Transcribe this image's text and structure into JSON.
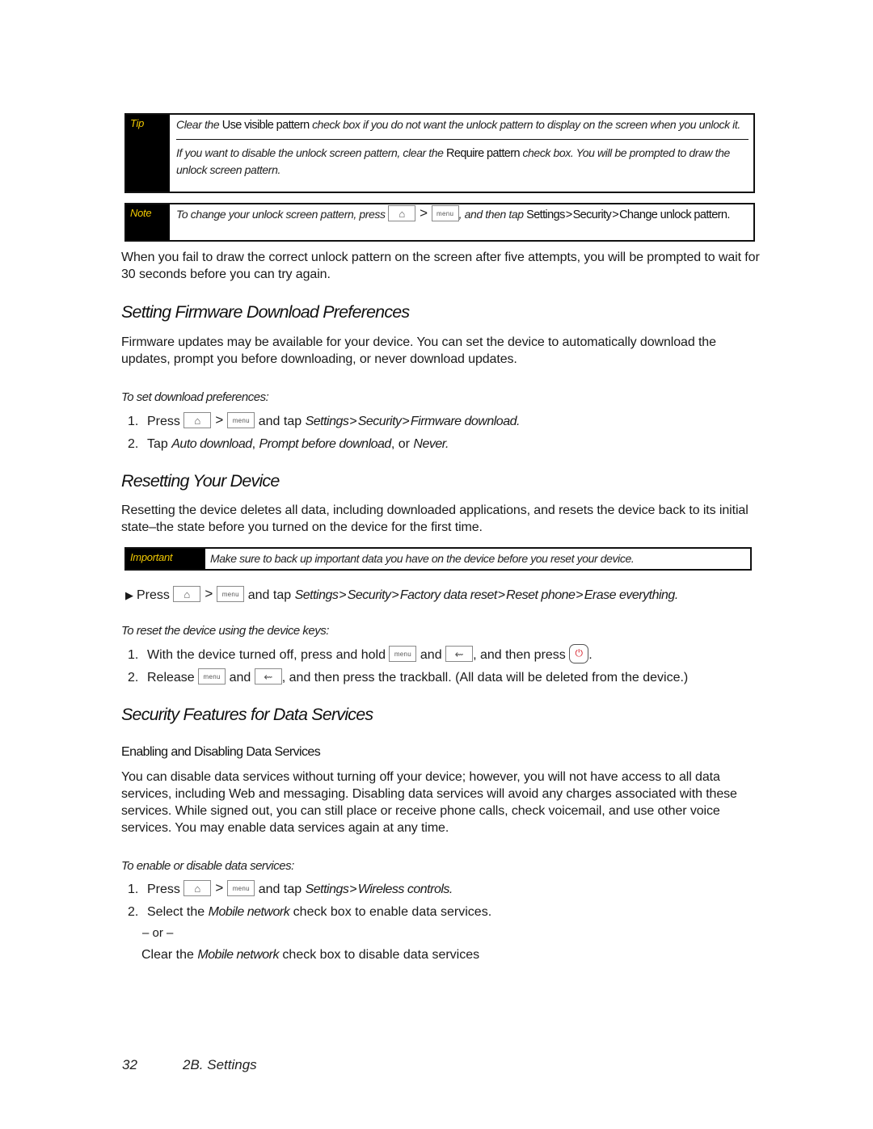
{
  "tip": {
    "label": "Tip",
    "item1": {
      "pre": "Clear the ",
      "ui": "Use visible pattern",
      "post": " check box if you do not want the unlock pattern to display on the screen when you unlock it."
    },
    "item2": {
      "pre": "If you want to disable the unlock screen pattern, clear the ",
      "ui": "Require pattern",
      "post": " check box. You will be prompted to draw the unlock screen pattern."
    }
  },
  "note": {
    "label": "Note",
    "pre": "To change your unlock screen pattern, press",
    "mid": ", and then tap ",
    "path": [
      "Settings",
      "Security",
      "Change unlock pattern"
    ],
    "post": "."
  },
  "keys": {
    "home_icon": "⌂",
    "menu_label": "menu",
    "back_icon": "⇜",
    "end_icon": "⏻",
    "separator": ">"
  },
  "intro_para": "When you fail to draw the correct unlock pattern on the screen after five attempts, you will be prompted to wait for 30 seconds before you can try again.",
  "firmware": {
    "heading": "Setting Firmware Download Preferences",
    "para": "Firmware updates may be available for your device. You can set the device to automatically download the updates, prompt you before downloading, or never download updates.",
    "procedure_title": "To set download preferences:",
    "step1": {
      "num": "1.",
      "press": "Press",
      "and_tap": " and tap ",
      "path": [
        "Settings",
        "Security",
        "Firmware download"
      ],
      "end": "."
    },
    "step2": {
      "num": "2.",
      "pre": "Tap ",
      "opt1": "Auto download",
      "comma": ", ",
      "opt2": "Prompt before download",
      "or": ", or ",
      "opt3": "Never",
      "end": "."
    }
  },
  "reset": {
    "heading": "Resetting Your Device",
    "para": "Resetting the device deletes all data, including downloaded applications, and resets the device back to its initial state–the state before you turned on the device for the first time.",
    "important": {
      "label": "Important",
      "text": "Make sure to back up important data you have on the device before you reset your device."
    },
    "bullet": {
      "icon": "▶",
      "press": "Press",
      "and_tap": " and tap ",
      "path": [
        "Settings",
        "Security",
        "Factory data reset",
        "Reset phone",
        "Erase everything"
      ],
      "end": "."
    },
    "procedure_title": "To reset the device using the device keys:",
    "step1": {
      "num": "1.",
      "pre": "With the device turned off, press and hold",
      "and": "and",
      "mid": ", and then press",
      "end": "."
    },
    "step2": {
      "num": "2.",
      "pre": "Release",
      "and": "and",
      "post": ", and then press the trackball. (All data will be deleted from the device.)"
    }
  },
  "data_services": {
    "heading": "Security Features for Data Services",
    "subheading": "Enabling and Disabling Data Services",
    "para": "You can disable data services without turning off your device; however, you will not have access to all data services, including Web and messaging. Disabling data services will avoid any charges associated with these services. While signed out, you can still place or receive phone calls, check voicemail, and use other voice services. You may enable data services again at any time.",
    "procedure_title": "To enable or disable data services:",
    "step1": {
      "num": "1.",
      "press": "Press",
      "and_tap": " and tap ",
      "path": [
        "Settings",
        "Wireless controls"
      ],
      "end": "."
    },
    "step2": {
      "num": "2.",
      "pre": "Select the ",
      "ui": "Mobile network",
      "post": " check box to enable data services."
    },
    "or_text": "– or –",
    "alt": {
      "pre": "Clear the ",
      "ui": "Mobile network",
      "post": " check box to disable data services"
    }
  },
  "footer": {
    "page_number": "32",
    "section": "2B. Settings"
  },
  "colors": {
    "callout_label": "#f0c800",
    "end_key_red": "#d6202a"
  }
}
